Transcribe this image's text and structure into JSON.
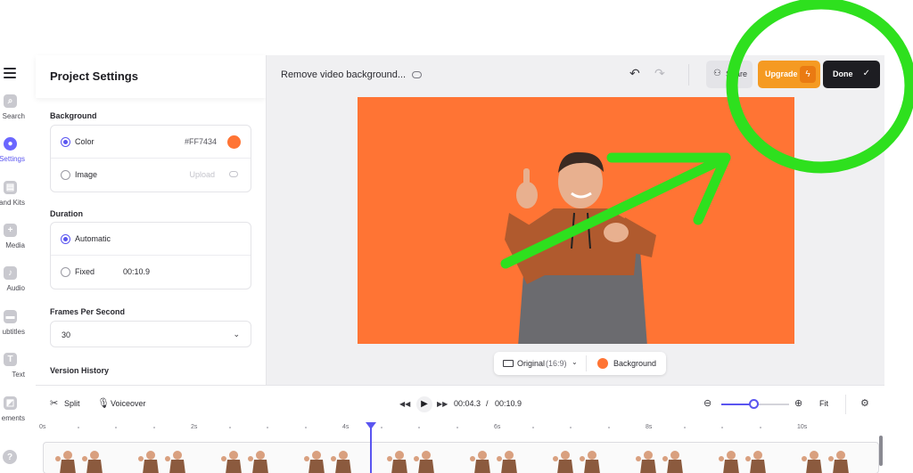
{
  "rail": {
    "items": [
      {
        "label": "Search",
        "icon": "search-icon"
      },
      {
        "label": "Settings",
        "icon": "settings-icon",
        "active": true
      },
      {
        "label": "and Kits",
        "icon": "brand-kit-icon"
      },
      {
        "label": "Media",
        "icon": "plus-icon"
      },
      {
        "label": "Audio",
        "icon": "music-note-icon"
      },
      {
        "label": "ubtitles",
        "icon": "subtitles-icon"
      },
      {
        "label": "Text",
        "icon": "text-icon"
      },
      {
        "label": "ements",
        "icon": "elements-icon"
      }
    ],
    "help": "?"
  },
  "panel": {
    "title": "Project Settings",
    "background": {
      "heading": "Background",
      "color_label": "Color",
      "color_value": "#FF7434",
      "image_label": "Image",
      "upload_label": "Upload"
    },
    "duration": {
      "heading": "Duration",
      "automatic_label": "Automatic",
      "fixed_label": "Fixed",
      "fixed_value": "00:10.9"
    },
    "fps": {
      "heading": "Frames Per Second",
      "value": "30"
    },
    "version_history": "Version History"
  },
  "toolbar": {
    "doc_title": "Remove video background...",
    "share": "Share",
    "upgrade": "Upgrade",
    "done": "Done"
  },
  "canvas": {
    "background_color": "#FF7434",
    "ratio_label": "Original",
    "ratio_sub": "(16:9)",
    "background_label": "Background"
  },
  "timeline": {
    "split": "Split",
    "voiceover": "Voiceover",
    "current_time": "00:04.3",
    "separator": "/",
    "total_time": "00:10.9",
    "fit": "Fit",
    "zoom_level": 0.47,
    "ruler": [
      "0s",
      "2s",
      "4s",
      "6s",
      "8s",
      "10s"
    ]
  },
  "colors": {
    "accent": "#5A55F0",
    "upgrade": "#F59A22",
    "done": "#1D1D22",
    "annotation": "#2EE01E"
  }
}
